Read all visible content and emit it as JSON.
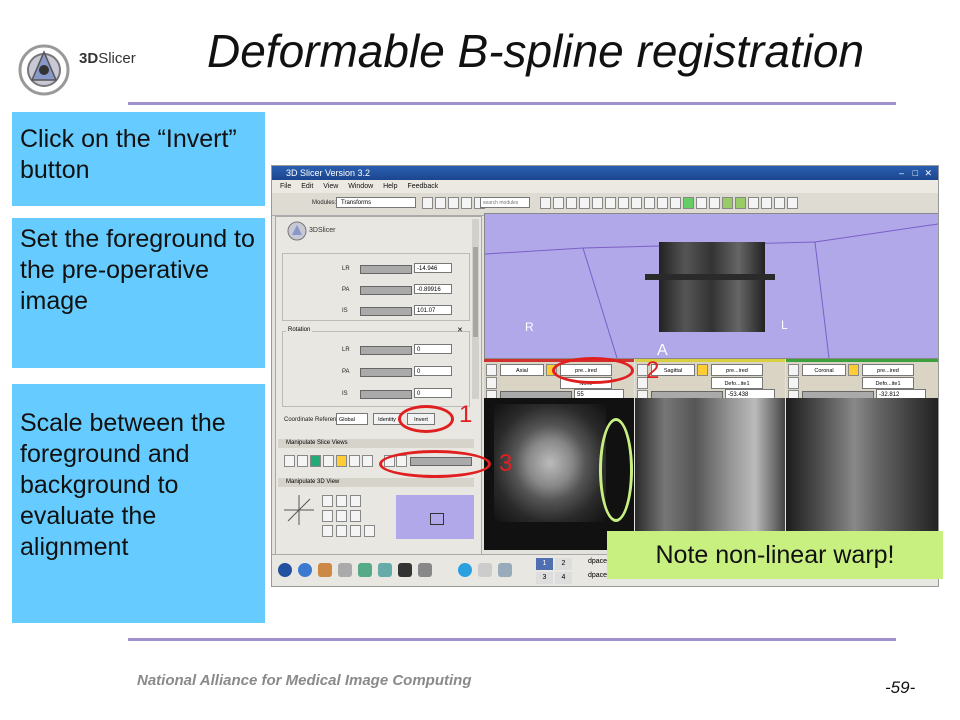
{
  "slide": {
    "title": "Deformable B-spline registration",
    "logo": {
      "prefix": "3D",
      "suffix": "Slicer"
    },
    "footer": "National Alliance for Medical Image Computing",
    "page_number": "-59-",
    "callouts": {
      "invert": "Click on the “Invert” button",
      "foreground": "Set the foreground to the pre-operative image",
      "scale": "Scale between the foreground and background to evaluate the alignment",
      "note": "Note non-linear warp!"
    },
    "markers": {
      "m1": "1",
      "m2": "2",
      "m3": "3"
    }
  },
  "app": {
    "window_title": "3D Slicer Version 3.2",
    "menu": [
      "File",
      "Edit",
      "View",
      "Window",
      "Help",
      "Feedback"
    ],
    "modules_label": "Modules:",
    "module_value": "Transforms",
    "search_placeholder": "search modules",
    "logo_text": "3DSlicer",
    "translation": {
      "rows": [
        {
          "label": "LR",
          "value": "-14.946"
        },
        {
          "label": "PA",
          "value": "-0.89916"
        },
        {
          "label": "IS",
          "value": "101.07"
        }
      ]
    },
    "rotation": {
      "title": "Rotation",
      "rows": [
        {
          "label": "LR",
          "value": "0"
        },
        {
          "label": "PA",
          "value": "0"
        },
        {
          "label": "IS",
          "value": "0"
        }
      ]
    },
    "coordinate_reference_label": "Coordinate Reference:",
    "coordinate_reference_value": "Global",
    "identity_button": "Identity",
    "invert_button": "Invert",
    "manipulate_slice_views": "Manipulate Slice Views",
    "manipulate_3d_view": "Manipulate 3D View",
    "view3d_labels": {
      "right": "R",
      "left": "L",
      "anterior": "A"
    },
    "slice_views": [
      {
        "orientation": "Axial",
        "fg": "pre...ired",
        "bg": "None",
        "offset": "55"
      },
      {
        "orientation": "Sagittal",
        "fg": "pre...ired",
        "bg": "Defo...ite1",
        "offset": "-53.438"
      },
      {
        "orientation": "Coronal",
        "fg": "pre...ired",
        "bg": "Defo...ite1",
        "offset": "-32.812"
      }
    ],
    "taskbar": {
      "workspaces": [
        "1",
        "2",
        "3",
        "4"
      ],
      "tasks": [
        "dpace",
        "dpace"
      ]
    }
  }
}
